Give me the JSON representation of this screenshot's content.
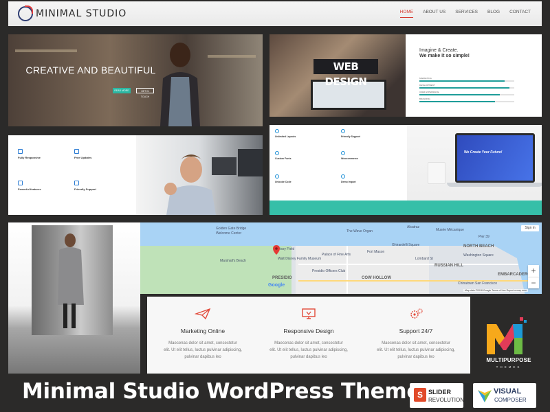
{
  "header": {
    "logo_text": "MINIMAL STUDIO",
    "nav": [
      {
        "label": "HOME",
        "active": true
      },
      {
        "label": "ABOUT US",
        "active": false
      },
      {
        "label": "SERVICES",
        "active": false
      },
      {
        "label": "BLOG",
        "active": false
      },
      {
        "label": "CONTACT",
        "active": false
      }
    ],
    "accent_color": "#d63a2f"
  },
  "hero": {
    "title": "CREATIVE AND BEAUTIFUL",
    "buttons": [
      "READ MORE",
      "GET IN TOUCH"
    ]
  },
  "webdesign": {
    "sign": "WEB DESIGN",
    "heading_line1": "Imagine & Create.",
    "heading_line2": "We make it so simple!",
    "skills": [
      {
        "label": "MARKETING",
        "percent": 90
      },
      {
        "label": "DEVELOPMENT",
        "percent": 95
      },
      {
        "label": "USER EXPERIENCE",
        "percent": 85
      },
      {
        "label": "BRANDING",
        "percent": 80
      }
    ],
    "bar_color": "#1e9d99"
  },
  "features_left": [
    {
      "title": "Fully Responsive"
    },
    {
      "title": "Free Updates"
    },
    {
      "title": "Powerful features"
    },
    {
      "title": "Friendly Support"
    }
  ],
  "features_laptop": [
    {
      "title": "Unlimited Layouts"
    },
    {
      "title": "Friendly Support"
    },
    {
      "title": "Custom Fonts"
    },
    {
      "title": "Woocommerce"
    },
    {
      "title": "Unicode Code"
    },
    {
      "title": "Demo Import"
    }
  ],
  "laptop": {
    "screen_text": "We Create Your Future!",
    "stripe_color": "#36bfa8"
  },
  "map": {
    "labels": [
      {
        "text": "Golden Gate Bridge"
      },
      {
        "text": "Welcome Center"
      },
      {
        "text": "Marshall's Beach"
      },
      {
        "text": "Crissy Field"
      },
      {
        "text": "Palace of Fine Arts"
      },
      {
        "text": "PRESIDIO"
      },
      {
        "text": "COW HOLLOW"
      },
      {
        "text": "NORTH BEACH"
      },
      {
        "text": "RUSSIAN HILL"
      },
      {
        "text": "Pier 39"
      },
      {
        "text": "EMBARCADERO"
      },
      {
        "text": "Washington Square"
      },
      {
        "text": "Chinatown San Francisco"
      },
      {
        "text": "Fort Mason"
      },
      {
        "text": "Ghirardelli Square"
      },
      {
        "text": "The Wave Organ"
      },
      {
        "text": "Alcatraz"
      },
      {
        "text": "Musée Mécanique"
      },
      {
        "text": "Presidio Officers Club"
      },
      {
        "text": "Walt Disney Family Museum"
      },
      {
        "text": "Lombard St"
      }
    ],
    "signin": "Sign in",
    "google": "Google",
    "footer": "Map data ©2018 Google   Terms of Use   Report a map error",
    "zoom_in": "+",
    "zoom_out": "−"
  },
  "services": [
    {
      "icon": "paper-plane-icon",
      "title": "Marketing Online",
      "lines": [
        "Maecenas dolor sit amet, consectetur",
        "elit. Ut elit tellus, luctus pulvinar adipiscing,",
        "pulvinar dapibus leo"
      ]
    },
    {
      "icon": "monitor-icon",
      "title": "Responsive Design",
      "lines": [
        "Maecenas dolor sit amet, consectetur",
        "elit. Ut elit tellus, luctus pulvinar adipiscing,",
        "pulvinar dapibus leo"
      ]
    },
    {
      "icon": "gears-icon",
      "title": "Support 24/7",
      "lines": [
        "Maecenas dolor sit amet, consectetur",
        "elit. Ut elit tellus, luctus pulvinar adipiscing,",
        "pulvinar dapibus leo"
      ]
    }
  ],
  "service_icon_color": "#e24a3a",
  "badge": {
    "title": "MULTIPURPOSE",
    "subtitle": "THEMES"
  },
  "footer": {
    "title": "Minimal Studio WordPress Themes",
    "slider_line1": "SLIDER",
    "slider_line2": "REVOLUTION",
    "vc_line1": "VISUAL",
    "vc_line2": "COMPOSER"
  }
}
